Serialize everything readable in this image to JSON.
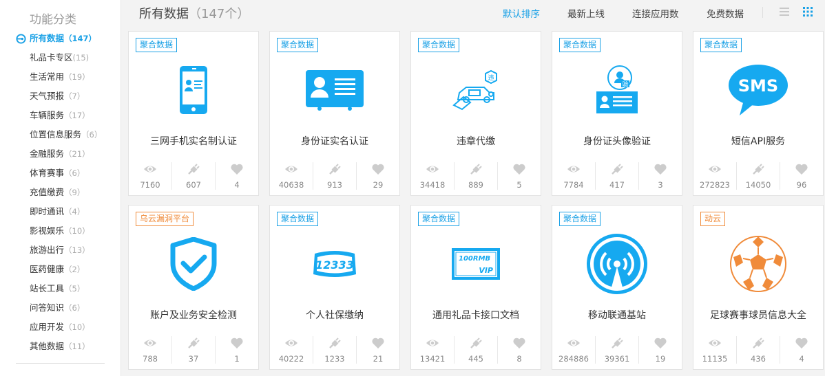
{
  "sidebar": {
    "title": "功能分类",
    "items": [
      {
        "label": "所有数据",
        "count": "（147）",
        "active": true
      },
      {
        "label": "礼品卡专区",
        "count": "(15)"
      },
      {
        "label": "生活常用",
        "count": "（19）"
      },
      {
        "label": "天气预报",
        "count": "（7）"
      },
      {
        "label": "车辆服务",
        "count": "（17）"
      },
      {
        "label": "位置信息服务",
        "count": "（6）"
      },
      {
        "label": "金融服务",
        "count": "（21）"
      },
      {
        "label": "体育赛事",
        "count": "（6）"
      },
      {
        "label": "充值缴费",
        "count": "（9）"
      },
      {
        "label": "即时通讯",
        "count": "（4）"
      },
      {
        "label": "影视娱乐",
        "count": "（10）"
      },
      {
        "label": "旅游出行",
        "count": "（13）"
      },
      {
        "label": "医药健康",
        "count": "（2）"
      },
      {
        "label": "站长工具",
        "count": "（5）"
      },
      {
        "label": "问答知识",
        "count": "（6）"
      },
      {
        "label": "应用开发",
        "count": "（10）"
      },
      {
        "label": "其他数据",
        "count": "（11）"
      }
    ]
  },
  "header": {
    "title": "所有数据",
    "count": "（147个）",
    "sorts": [
      "默认排序",
      "最新上线",
      "连接应用数",
      "免费数据"
    ],
    "active_sort": 0
  },
  "colors": {
    "accent": "#1aa1e6",
    "orange": "#f08b3a",
    "icon_blue": "#16a9f0"
  },
  "cards": [
    {
      "tag": "聚合数据",
      "tag_color": "blue",
      "icon": "mobile-id-icon",
      "name": "三网手机实名制认证",
      "views": "7160",
      "apps": "607",
      "likes": "4"
    },
    {
      "tag": "聚合数据",
      "tag_color": "blue",
      "icon": "id-card-icon",
      "name": "身份证实名认证",
      "views": "40638",
      "apps": "913",
      "likes": "29"
    },
    {
      "tag": "聚合数据",
      "tag_color": "blue",
      "icon": "car-violation-icon",
      "name": "违章代缴",
      "views": "34418",
      "apps": "889",
      "likes": "5"
    },
    {
      "tag": "聚合数据",
      "tag_color": "blue",
      "icon": "face-verify-icon",
      "name": "身份证头像验证",
      "views": "7784",
      "apps": "417",
      "likes": "3"
    },
    {
      "tag": "聚合数据",
      "tag_color": "blue",
      "icon": "sms-icon",
      "name": "短信API服务",
      "views": "272823",
      "apps": "14050",
      "likes": "96",
      "icon_text": "SMS"
    },
    {
      "tag": "乌云漏洞平台",
      "tag_color": "orange",
      "icon": "shield-check-icon",
      "name": "账户及业务安全检测",
      "views": "788",
      "apps": "37",
      "likes": "1"
    },
    {
      "tag": "聚合数据",
      "tag_color": "blue",
      "icon": "social-security-icon",
      "name": "个人社保缴纳",
      "views": "40222",
      "apps": "1233",
      "likes": "21",
      "icon_text": "12333"
    },
    {
      "tag": "聚合数据",
      "tag_color": "blue",
      "icon": "gift-card-icon",
      "name": "通用礼品卡接口文档",
      "views": "13421",
      "apps": "445",
      "likes": "8",
      "icon_text": "100RMB",
      "icon_text2": "VIP"
    },
    {
      "tag": "聚合数据",
      "tag_color": "blue",
      "icon": "base-station-icon",
      "name": "移动联通基站",
      "views": "284886",
      "apps": "39361",
      "likes": "19"
    },
    {
      "tag": "动云",
      "tag_color": "orange",
      "icon": "football-icon",
      "name": "足球赛事球员信息大全",
      "views": "11135",
      "apps": "436",
      "likes": "4"
    }
  ]
}
